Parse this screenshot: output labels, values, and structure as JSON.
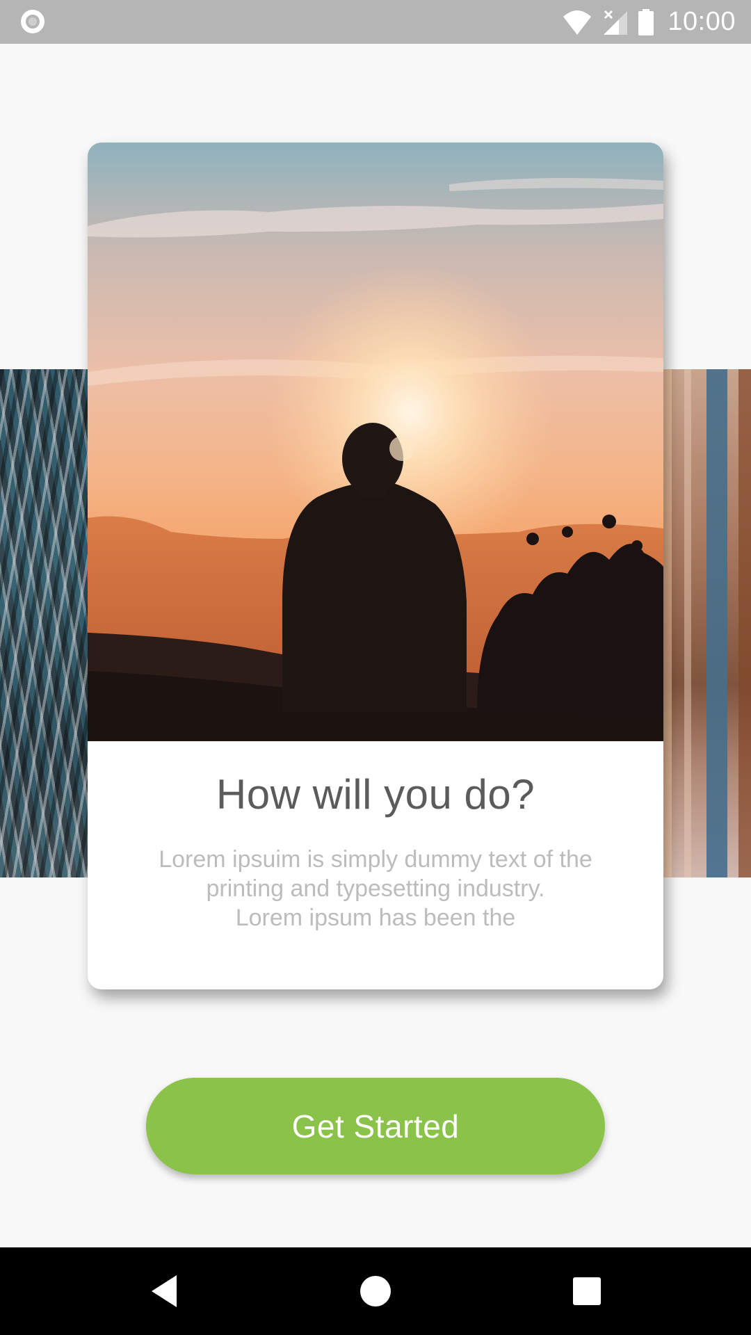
{
  "status_bar": {
    "time": "10:00",
    "icons": [
      "notification-ring-icon",
      "wifi-icon",
      "no-signal-icon",
      "battery-icon"
    ],
    "background": "#b5b5b5"
  },
  "card": {
    "title": "How will you do?",
    "body_lines": [
      "Lorem ipsuim is simply dummy text of the",
      "printing and typesetting industry.",
      "Lorem ipsum has been the"
    ],
    "image": "person-sitting-at-sunset-photo"
  },
  "side_cards": {
    "left_image": "tree-bark-photo",
    "right_image": "forest-trees-photo"
  },
  "button": {
    "label": "Get Started",
    "color": "#8bc34a"
  },
  "nav_bar": {
    "icons": [
      "back-icon",
      "home-icon",
      "recents-icon"
    ]
  }
}
